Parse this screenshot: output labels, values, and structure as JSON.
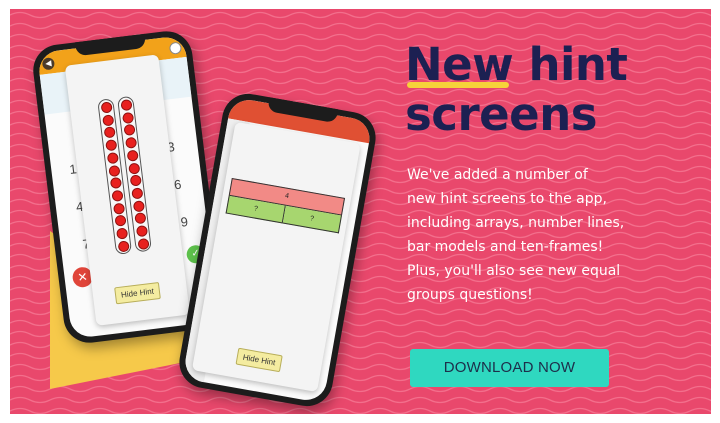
{
  "colors": {
    "background": "#e9486c",
    "headline": "#1c2052",
    "underline": "#f6d23a",
    "button": "#2fd8c0",
    "button_text": "#1d2f4a",
    "accent_triangle": "#f6c94a"
  },
  "headline": {
    "word_new": "New",
    "word_hint": "hint",
    "word_screens": "screens"
  },
  "body": {
    "lines": [
      "We've added a number of",
      "new hint screens to the app,",
      "including arrays, number lines,",
      "bar models and ten-frames!",
      "Plus, you'll also see new equal",
      "groups questions!"
    ]
  },
  "cta": {
    "label": "DOWNLOAD NOW"
  },
  "phone_left": {
    "keys": [
      "1",
      "3",
      "4",
      "6",
      "7",
      "9"
    ],
    "hint_button": "Hide Hint",
    "array_rows": 12,
    "array_columns": 2
  },
  "phone_right": {
    "bar_whole": "4",
    "bar_parts": [
      "?",
      "?"
    ],
    "hint_button": "Hide Hint"
  }
}
